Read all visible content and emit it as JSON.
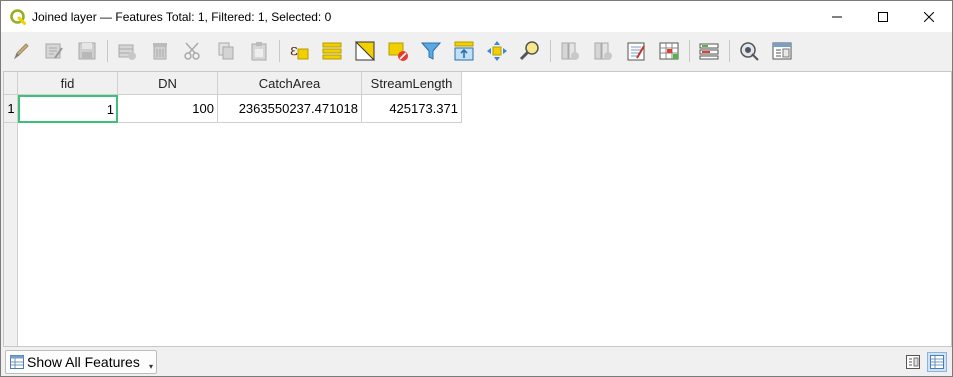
{
  "window": {
    "title": "Joined layer — Features Total: 1, Filtered: 1, Selected: 0"
  },
  "window_controls": [
    "minimize",
    "maximize",
    "close"
  ],
  "toolbar": {
    "buttons": [
      {
        "icon": "pencil-edit-icon",
        "enabled": false
      },
      {
        "icon": "multi-edit-icon",
        "enabled": false
      },
      {
        "icon": "save-edits-icon",
        "enabled": false
      },
      {
        "icon": "add-feature-icon",
        "enabled": false
      },
      {
        "icon": "delete-feature-icon",
        "enabled": false
      },
      {
        "icon": "cut-icon",
        "enabled": false
      },
      {
        "icon": "copy-icon",
        "enabled": false
      },
      {
        "icon": "paste-icon",
        "enabled": false
      },
      {
        "icon": "select-by-expression-icon",
        "enabled": true
      },
      {
        "icon": "select-all-icon",
        "enabled": true
      },
      {
        "icon": "invert-selection-icon",
        "enabled": true
      },
      {
        "icon": "deselect-all-icon",
        "enabled": true
      },
      {
        "icon": "filter-icon",
        "enabled": true
      },
      {
        "icon": "move-selection-to-top-icon",
        "enabled": true
      },
      {
        "icon": "pan-to-selected-icon",
        "enabled": true
      },
      {
        "icon": "zoom-to-selected-icon",
        "enabled": true
      },
      {
        "icon": "new-field-icon",
        "enabled": false
      },
      {
        "icon": "delete-field-icon",
        "enabled": false
      },
      {
        "icon": "field-calculator-icon",
        "enabled": true
      },
      {
        "icon": "conditional-formatting-icon",
        "enabled": true
      },
      {
        "icon": "dock-icon",
        "enabled": true
      },
      {
        "icon": "actions-icon",
        "enabled": true
      },
      {
        "icon": "form-view-icon",
        "enabled": true
      }
    ]
  },
  "table": {
    "columns": [
      "fid",
      "DN",
      "CatchArea",
      "StreamLength"
    ],
    "rows": [
      {
        "row_number": "1",
        "cells": [
          "1",
          "100",
          "2363550237.471018",
          "425173.371"
        ]
      }
    ]
  },
  "bottombar": {
    "filter_label": "Show All Features",
    "view_modes": [
      "form-view-icon",
      "table-view-icon"
    ],
    "active_view": "table-view-icon"
  },
  "colors": {
    "accent_focus": "#3cc07a",
    "qgis_green": "#93b023",
    "selection_yellow": "#f2d000"
  }
}
